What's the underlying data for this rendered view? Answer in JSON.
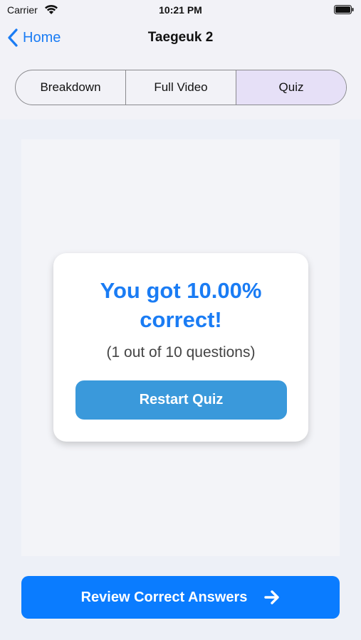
{
  "status_bar": {
    "carrier": "Carrier",
    "time": "10:21 PM"
  },
  "nav": {
    "back_label": "Home",
    "title": "Taegeuk 2"
  },
  "segments": [
    {
      "label": "Breakdown",
      "selected": false
    },
    {
      "label": "Full Video",
      "selected": false
    },
    {
      "label": "Quiz",
      "selected": true
    }
  ],
  "result": {
    "title": "You got 10.00% correct!",
    "detail": "(1 out of 10 questions)",
    "restart_label": "Restart Quiz"
  },
  "review": {
    "label": "Review Correct Answers"
  },
  "colors": {
    "accent": "#1a7cf4",
    "primary_button": "#0a7cff",
    "restart_button": "#3a99db",
    "selected_segment": "#e6e0f7"
  }
}
